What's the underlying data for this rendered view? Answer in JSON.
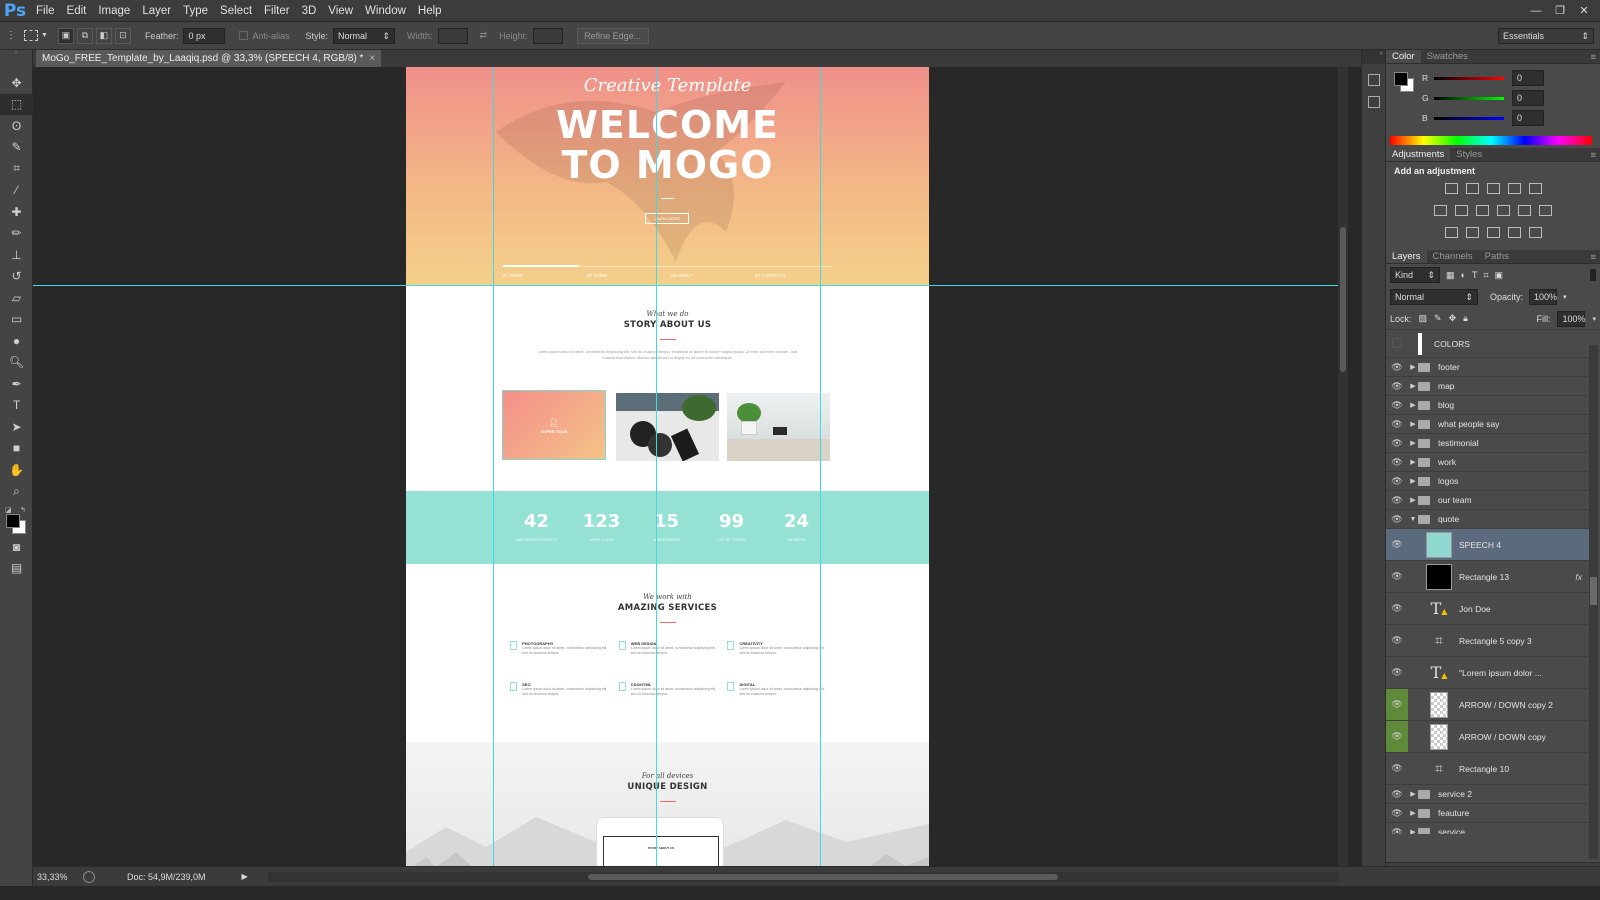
{
  "app": {
    "logo": "Ps"
  },
  "menu": [
    "File",
    "Edit",
    "Image",
    "Layer",
    "Type",
    "Select",
    "Filter",
    "3D",
    "View",
    "Window",
    "Help"
  ],
  "options": {
    "feather_label": "Feather:",
    "feather_value": "0 px",
    "antialias_label": "Anti-alias",
    "style_label": "Style:",
    "style_value": "Normal",
    "width_label": "Width:",
    "height_label": "Height:",
    "refine_edge": "Refine Edge...",
    "workspace": "Essentials"
  },
  "document": {
    "tab_title": "MoGo_FREE_Template_by_Laaqiq.psd @ 33,3% (SPEECH 4, RGB/8) *",
    "tab_close": "×"
  },
  "design": {
    "hero_script": "Creative Template",
    "hero_line1": "WELCOME",
    "hero_line2": "TO MOGO",
    "hero_button": "LEARN MORE",
    "hero_nav": [
      "01 INTRO",
      "02 WORK",
      "03 ABOUT",
      "04 CONTACTS"
    ],
    "story_sub": "What we do",
    "story_title": "STORY ABOUT US",
    "story_text": "Lorem ipsum dolor sit amet, consectetur adipiscing elit, sed do eiusmod tempor incididunt ut labore et dolore magna aliqua. Ut enim ad minim veniam, quis nostrud exercitation ullamco laboris nisi ut aliquip ex ea commodo consequat.",
    "card1_label": "SUPER TEAM",
    "stats": [
      {
        "num": "42",
        "label": "WEB DESIGN PROJECTS"
      },
      {
        "num": "123",
        "label": "HAPPY CLIENT"
      },
      {
        "num": "15",
        "label": "AWARD WINNER"
      },
      {
        "num": "99",
        "label": "CUP OF COFFEE"
      },
      {
        "num": "24",
        "label": "MEMBERS"
      }
    ],
    "services_sub": "We work with",
    "services_title": "AMAZING SERVICES",
    "services": [
      {
        "title": "PHOTOGRAPHY",
        "text": "Lorem ipsum dolor sit amet, consectetur adipiscing elit, sed do eiusmod tempor."
      },
      {
        "title": "WEB DESIGN",
        "text": "Lorem ipsum dolor sit amet, consectetur adipiscing elit, sed do eiusmod tempor."
      },
      {
        "title": "CREATIVITY",
        "text": "Lorem ipsum dolor sit amet, consectetur adipiscing elit, sed do eiusmod tempor."
      },
      {
        "title": "SEO",
        "text": "Lorem ipsum dolor sit amet, consectetur adipiscing elit, sed do eiusmod tempor."
      },
      {
        "title": "CSS/HTML",
        "text": "Lorem ipsum dolor sit amet, consectetur adipiscing elit, sed do eiusmod tempor."
      },
      {
        "title": "DIGITAL",
        "text": "Lorem ipsum dolor sit amet, consectetur adipiscing elit, sed do eiusmod tempor."
      }
    ],
    "unique_sub": "For all devices",
    "unique_title": "UNIQUE DESIGN",
    "mock_text": "STORY ABOUT US"
  },
  "color_panel": {
    "tabs": [
      "Color",
      "Swatches"
    ],
    "r_label": "R",
    "g_label": "G",
    "b_label": "B",
    "r": "0",
    "g": "0",
    "b": "0"
  },
  "adjust_panel": {
    "tabs": [
      "Adjustments",
      "Styles"
    ],
    "heading": "Add an adjustment"
  },
  "layers_panel": {
    "tabs": [
      "Layers",
      "Channels",
      "Paths"
    ],
    "kind": "Kind",
    "blend": "Normal",
    "opacity_label": "Opacity:",
    "opacity": "100%",
    "lock_label": "Lock:",
    "fill_label": "Fill:",
    "fill": "100%",
    "layers": [
      {
        "name": "COLORS",
        "type": "layer",
        "visible": false
      },
      {
        "name": "footer",
        "type": "folder"
      },
      {
        "name": "map",
        "type": "folder"
      },
      {
        "name": "blog",
        "type": "folder"
      },
      {
        "name": "what people say",
        "type": "folder"
      },
      {
        "name": "testimonial",
        "type": "folder"
      },
      {
        "name": "work",
        "type": "folder"
      },
      {
        "name": "logos",
        "type": "folder"
      },
      {
        "name": "our team",
        "type": "folder"
      },
      {
        "name": "quote",
        "type": "folder",
        "open": true
      },
      {
        "name": "SPEECH 4",
        "type": "image",
        "selected": true
      },
      {
        "name": "Rectangle 13",
        "type": "black",
        "fx": "fx"
      },
      {
        "name": "Jon Doe",
        "type": "text"
      },
      {
        "name": "Rectangle 5 copy 3",
        "type": "shape"
      },
      {
        "name": "\"Lorem ipsum dolor ...",
        "type": "text"
      },
      {
        "name": "ARROW / DOWN copy 2",
        "type": "checker",
        "green": true
      },
      {
        "name": "ARROW / DOWN copy",
        "type": "checker",
        "green": true
      },
      {
        "name": "Rectangle 10",
        "type": "shape"
      },
      {
        "name": "service 2",
        "type": "folder"
      },
      {
        "name": "feauture",
        "type": "folder"
      },
      {
        "name": "service",
        "type": "folder"
      }
    ]
  },
  "status": {
    "zoom": "33,33%",
    "doc": "Doc: 54,9M/239,0M"
  }
}
